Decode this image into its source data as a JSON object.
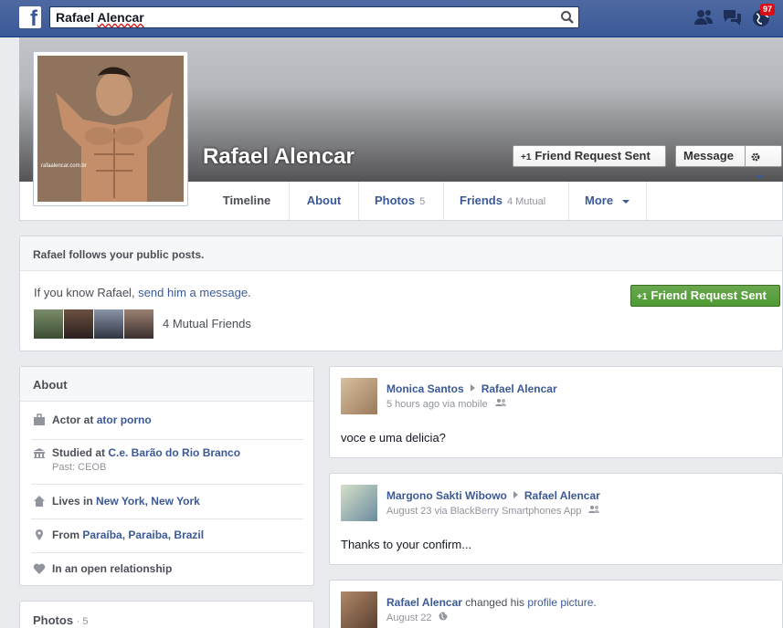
{
  "topbar": {
    "logo": "f",
    "search_value": "Rafael ",
    "search_value_misspelled": "Alencar",
    "notifications_count": "97",
    "icons": [
      "friend-requests-icon",
      "messages-icon",
      "notifications-globe-icon",
      "search-icon"
    ]
  },
  "profile": {
    "name": "Rafael Alencar",
    "picture_watermark": "rafaalencar.com.br",
    "friend_request_label": "Friend Request Sent",
    "message_label": "Message"
  },
  "tabs": [
    {
      "label": "Timeline",
      "count": ""
    },
    {
      "label": "About",
      "count": ""
    },
    {
      "label": "Photos",
      "count": "5"
    },
    {
      "label": "Friends",
      "count": "4 Mutual"
    },
    {
      "label": "More",
      "count": ""
    }
  ],
  "follow_box": {
    "heading": "Rafael follows your public posts.",
    "line_prefix": "If you know Rafael, ",
    "line_link": "send him a message",
    "line_suffix": ".",
    "friend_request_label": "Friend Request Sent",
    "mutual_friends_text": "4 Mutual Friends"
  },
  "about": {
    "title": "About",
    "rows": [
      {
        "prefix": "Actor at ",
        "link": "ator porno",
        "sub": ""
      },
      {
        "prefix": "Studied at ",
        "link": "C.e. Barão do Rio Branco",
        "sub": "Past: CEOB"
      },
      {
        "prefix": "Lives in ",
        "link": "New York, New York",
        "sub": ""
      },
      {
        "prefix": "From ",
        "link": "Paraíba, Paraiba, Brazil",
        "sub": ""
      },
      {
        "prefix": "In an open relationship",
        "link": "",
        "sub": ""
      }
    ]
  },
  "photos_card": {
    "title": "Photos",
    "count": "· 5"
  },
  "posts": [
    {
      "author": "Monica Santos",
      "target": "Rafael Alencar",
      "meta": "5 hours ago via mobile",
      "body": "voce e uma delicia?"
    },
    {
      "author": "Margono Sakti Wibowo",
      "target": "Rafael Alencar",
      "meta": "August 23 via BlackBerry Smartphones App",
      "body": "Thanks to your confirm..."
    },
    {
      "author": "Rafael Alencar",
      "action": " changed his ",
      "link": "profile picture",
      "suffix": ".",
      "meta": "August 22"
    }
  ],
  "colors": {
    "brand_blue": "#3b5998",
    "green_button": "#4e9a33",
    "notification_red": "#dc0d17"
  }
}
